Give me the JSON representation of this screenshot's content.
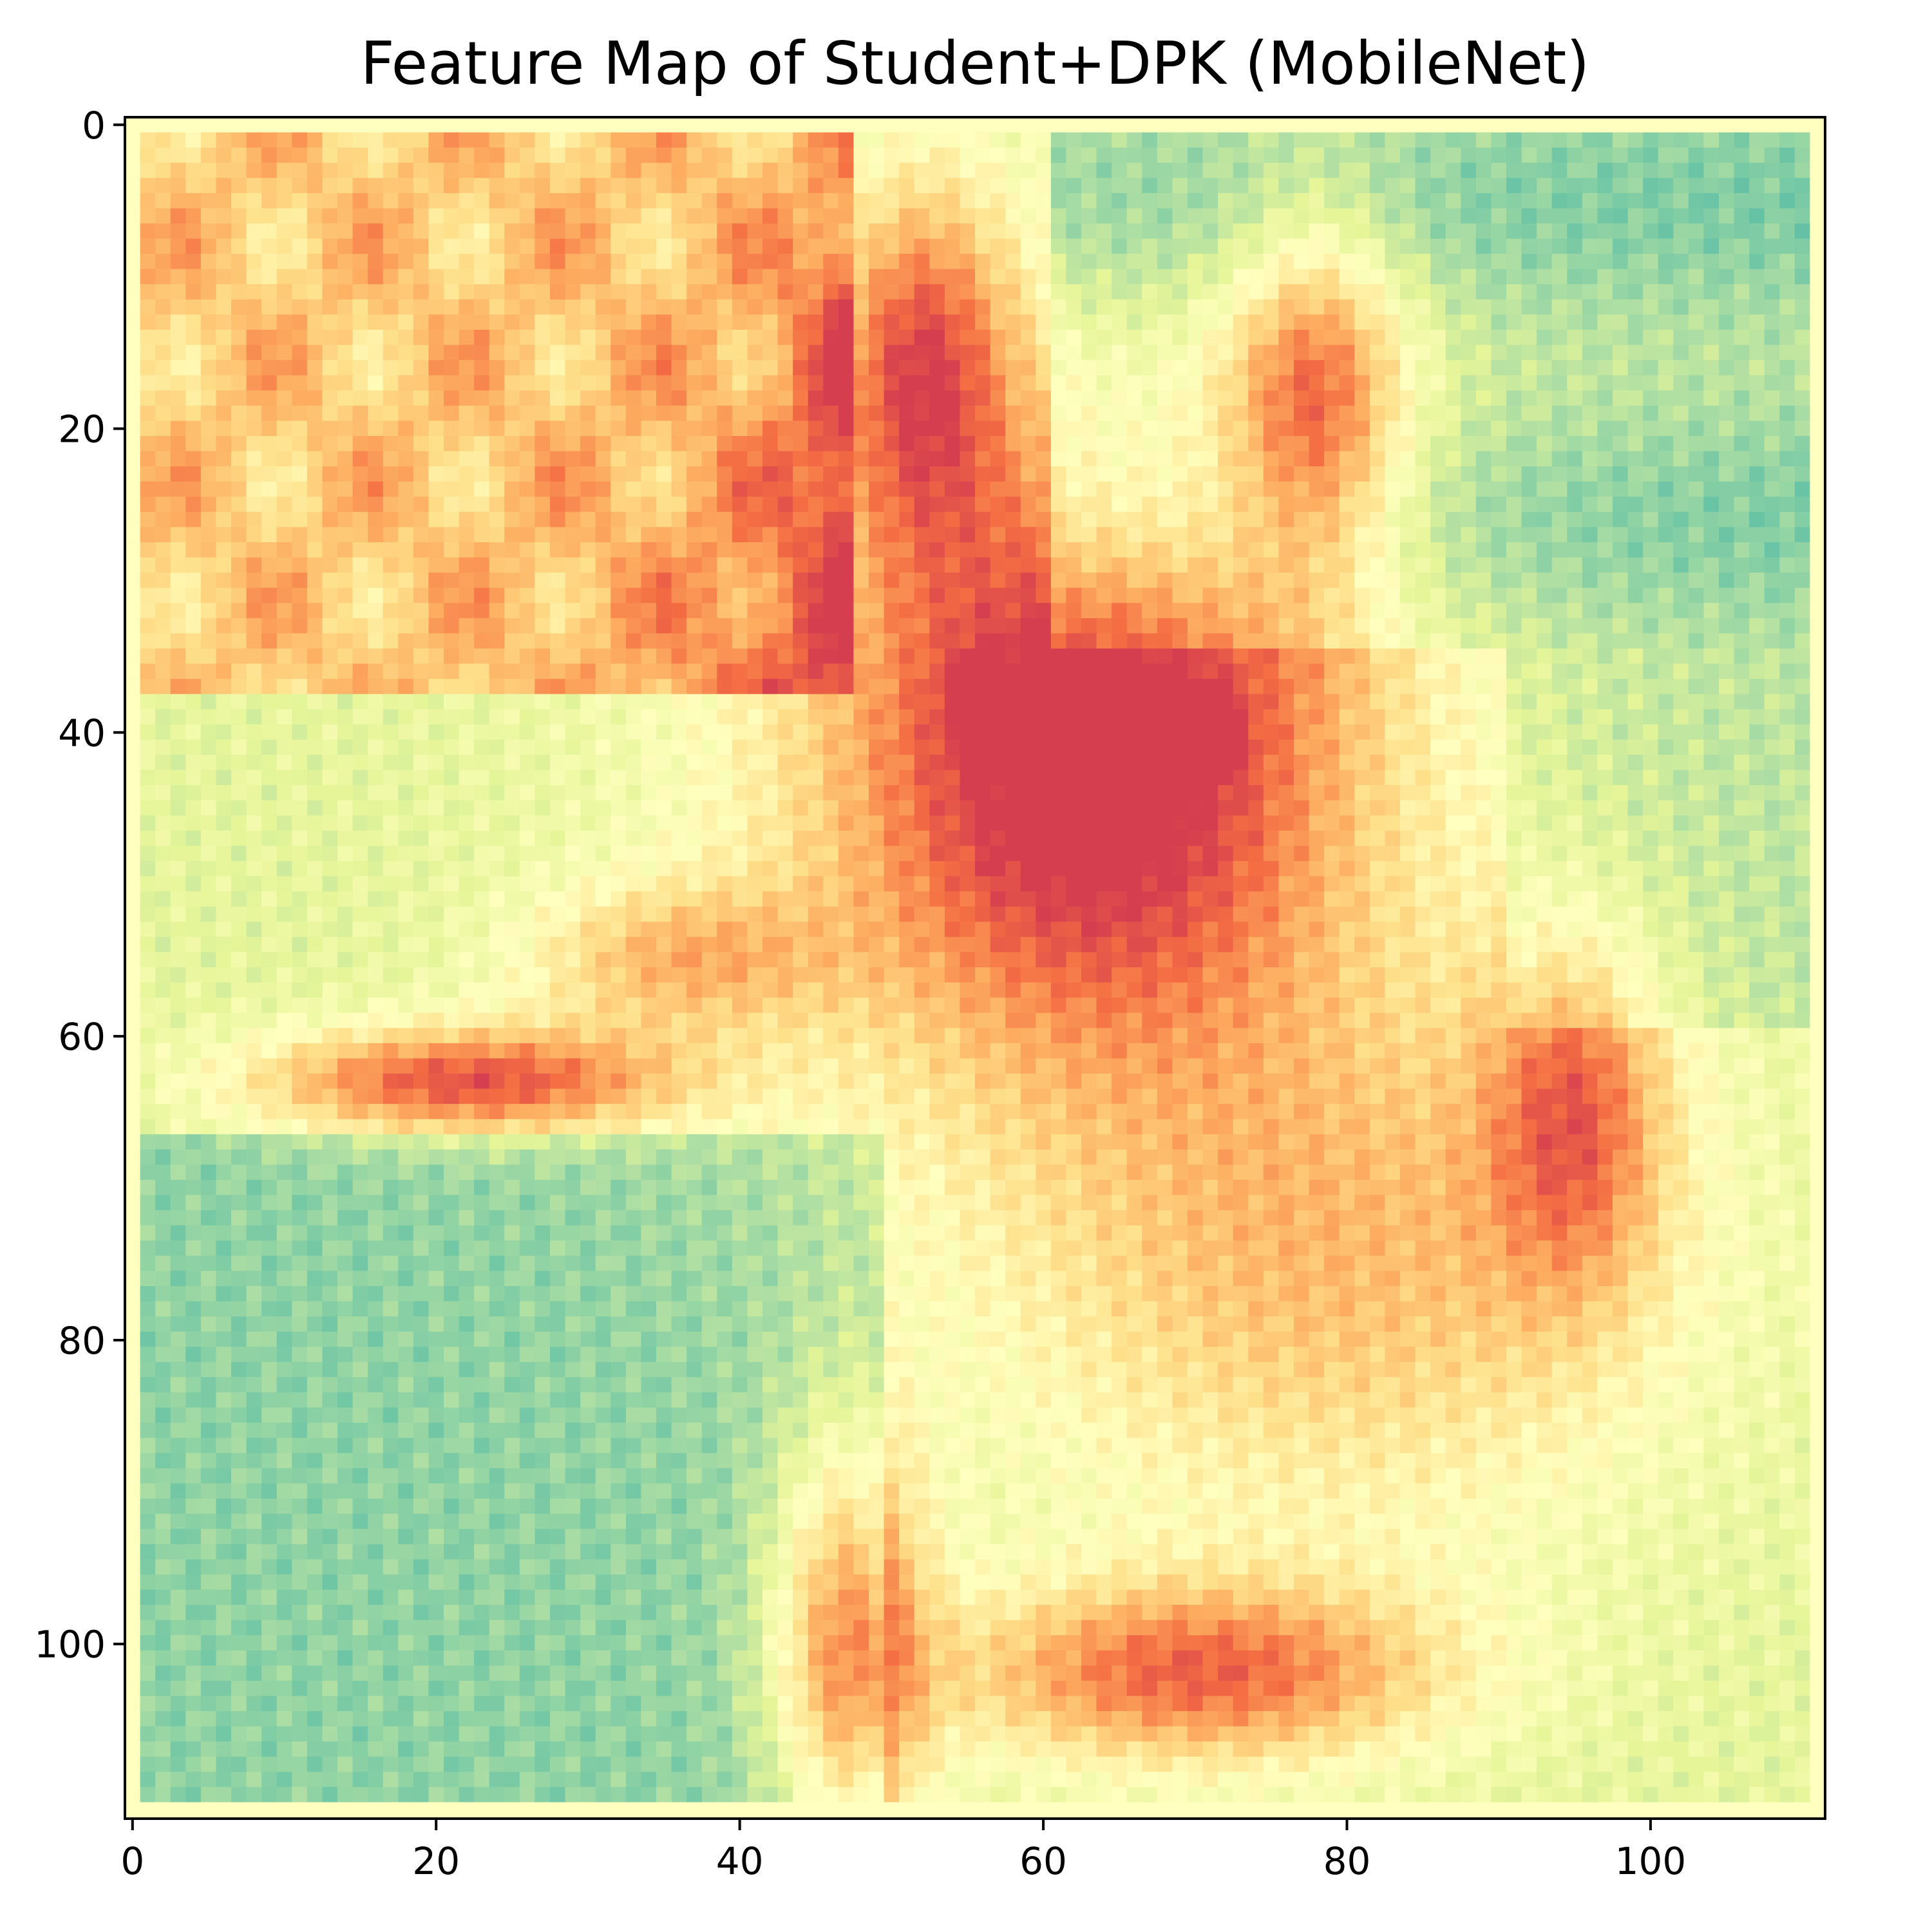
{
  "chart_data": {
    "type": "heatmap",
    "title": "Feature Map of Student+DPK (MobileNet)",
    "xlabel": "",
    "ylabel": "",
    "colormap": "Spectral",
    "colormap_stops": [
      "#d53e4f",
      "#f46d43",
      "#fdae61",
      "#fee08b",
      "#ffffbf",
      "#e6f598",
      "#abdda4",
      "#66c2a5",
      "#3288bd"
    ],
    "grid_size": [
      112,
      112
    ],
    "xlim": [
      -0.5,
      111.5
    ],
    "ylim": [
      111.5,
      -0.5
    ],
    "x_ticks": [
      0,
      20,
      40,
      60,
      80,
      100
    ],
    "y_ticks": [
      0,
      20,
      40,
      60,
      80,
      100
    ],
    "x_tick_labels": [
      "0",
      "20",
      "40",
      "60",
      "80",
      "100"
    ],
    "y_tick_labels": [
      "0",
      "20",
      "40",
      "60",
      "80",
      "100"
    ],
    "grid": false,
    "description_of_regions": [
      {
        "region": "background top-right",
        "level": "low (teal)"
      },
      {
        "region": "cat head and ears",
        "level": "high (red-orange)"
      },
      {
        "region": "cat eyes",
        "level": "very high (dark red)"
      },
      {
        "region": "paw / stick left",
        "level": "high (red)"
      },
      {
        "region": "lower-left ground",
        "level": "low (blue-teal)"
      },
      {
        "region": "legs bottom center",
        "level": "high (red)"
      }
    ]
  }
}
